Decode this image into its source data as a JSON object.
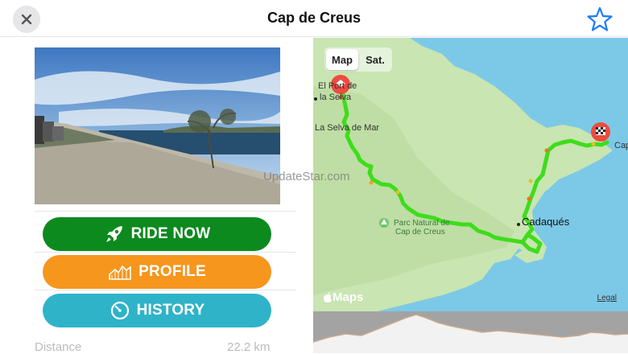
{
  "header": {
    "title": "Cap de Creus",
    "close_icon": "close-icon",
    "favorite_icon": "star-icon"
  },
  "actions": {
    "ride_now": "RIDE NOW",
    "profile": "PROFILE",
    "history": "HISTORY"
  },
  "stats": {
    "distance_label": "Distance",
    "distance_value": "22.2 km"
  },
  "map": {
    "tab_map": "Map",
    "tab_sat": "Sat.",
    "labels": {
      "town1a": "El Port de",
      "town1b": "la Selva",
      "town2": "La Selva de Mar",
      "town3": "Cadaqués",
      "park1": "Parc Natural de",
      "park2": "Cap de Creus",
      "cape": "Cap"
    },
    "attribution": "Maps",
    "legal": "Legal"
  },
  "watermark": "UpdateStar.com",
  "colors": {
    "ride": "#0c8a1e",
    "profile": "#f6961d",
    "history": "#2fb3c9",
    "route": "#39d81a",
    "accent": "#1a7cf5"
  }
}
